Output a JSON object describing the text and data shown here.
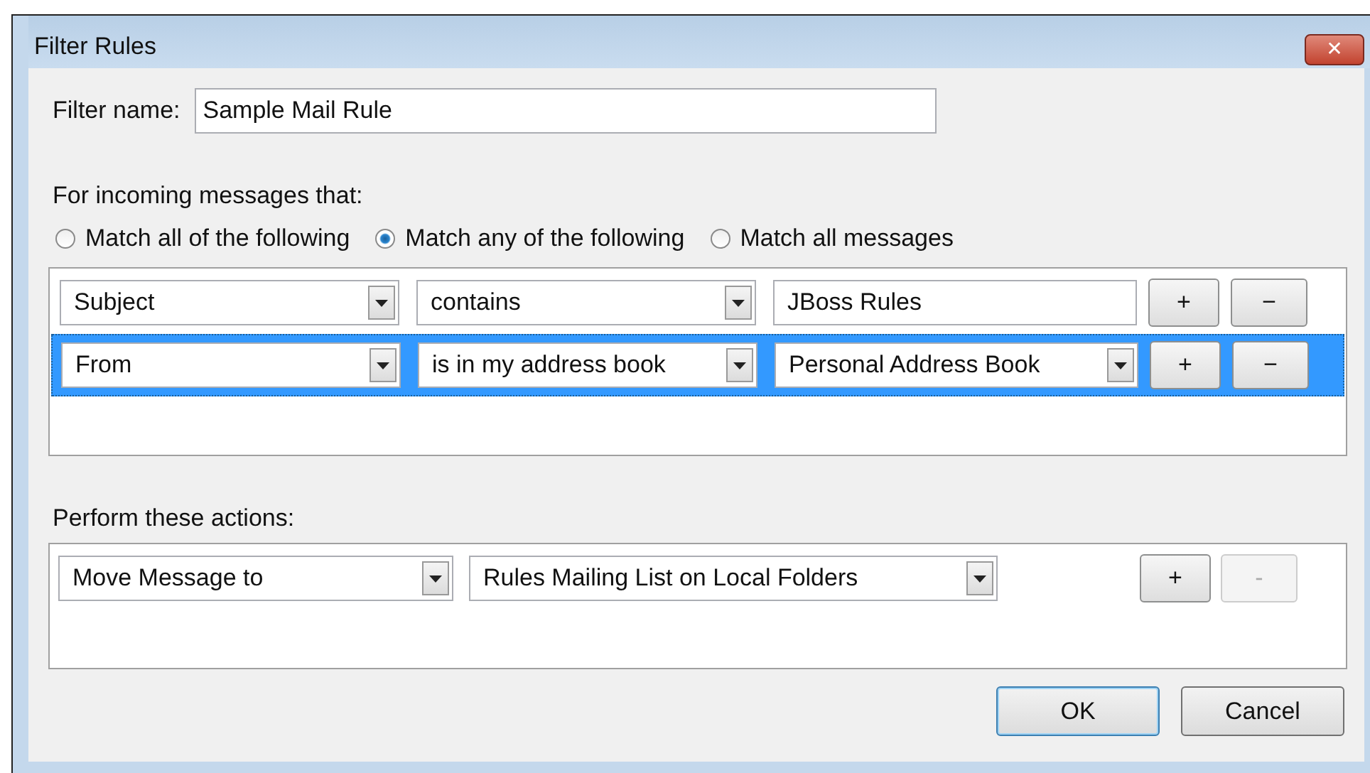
{
  "window": {
    "title": "Filter Rules",
    "close": "✕"
  },
  "filter_name": {
    "label": "Filter name:",
    "value": "Sample Mail Rule"
  },
  "conditions_label": "For incoming messages that:",
  "match_options": [
    {
      "label": "Match all of the following",
      "selected": false
    },
    {
      "label": "Match any of the following",
      "selected": true
    },
    {
      "label": "Match all messages",
      "selected": false
    }
  ],
  "conditions": [
    {
      "field": "Subject",
      "operator": "contains",
      "value": {
        "kind": "text",
        "text": "JBoss Rules"
      },
      "selected": false,
      "add": "+",
      "remove": "−"
    },
    {
      "field": "From",
      "operator": "is in my address book",
      "value": {
        "kind": "dropdown",
        "text": "Personal Address Book"
      },
      "selected": true,
      "add": "+",
      "remove": "−"
    }
  ],
  "actions_label": "Perform these actions:",
  "actions": [
    {
      "action": "Move Message to",
      "target": "Rules Mailing List on Local Folders",
      "add": "+",
      "remove": "-",
      "remove_disabled": true
    }
  ],
  "buttons": [
    {
      "label": "OK",
      "default": true
    },
    {
      "label": "Cancel",
      "default": false
    }
  ]
}
